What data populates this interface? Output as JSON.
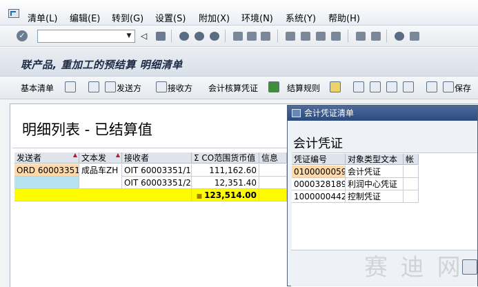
{
  "menu": {
    "items": [
      "清单(L)",
      "编辑(E)",
      "转到(G)",
      "设置(S)",
      "附加(X)",
      "环境(N)",
      "系统(Y)",
      "帮助(H)"
    ]
  },
  "toolbar": {
    "command_field_value": ""
  },
  "title": {
    "text": "联产品, 重加工的预结算 明细清单"
  },
  "app_toolbar": {
    "basic_list": "基本清单",
    "sender": "发送方",
    "receiver": "接收方",
    "accounting_doc": "会计核算凭证",
    "settlement_rule": "结算规则",
    "save": "保存"
  },
  "main_list": {
    "heading": "明细列表 - 已结算值",
    "columns": [
      "发送者",
      "文本发",
      "接收者",
      "Σ CO范围货币值",
      "信息"
    ],
    "rows": [
      {
        "sender": "ORD 60003351",
        "text": "成品车ZH",
        "receiver": "OIT 60003351/1",
        "value": "111,162.60",
        "info": ""
      },
      {
        "sender": "",
        "text": "",
        "receiver": "OIT 60003351/2",
        "value": "12,351.40",
        "info": ""
      }
    ],
    "total": "123,514.00"
  },
  "popup": {
    "title": "会计凭证清单",
    "heading": "会计凭证",
    "columns": [
      "凭证编号",
      "对象类型文本",
      "帐"
    ],
    "rows": [
      {
        "doc_no": "0100000059",
        "type": "会计凭证",
        "acct": ""
      },
      {
        "doc_no": "0000328189",
        "type": "利润中心凭证",
        "acct": ""
      },
      {
        "doc_no": "1000000442",
        "type": "控制凭证",
        "acct": ""
      }
    ]
  },
  "colors": {
    "highlight_orange": "#ffd9a8",
    "highlight_cyan": "#b7e3f0",
    "total_yellow": "#fffb00",
    "popup_title_blue": "#2b4b7e"
  },
  "watermark": "赛 迪 网"
}
